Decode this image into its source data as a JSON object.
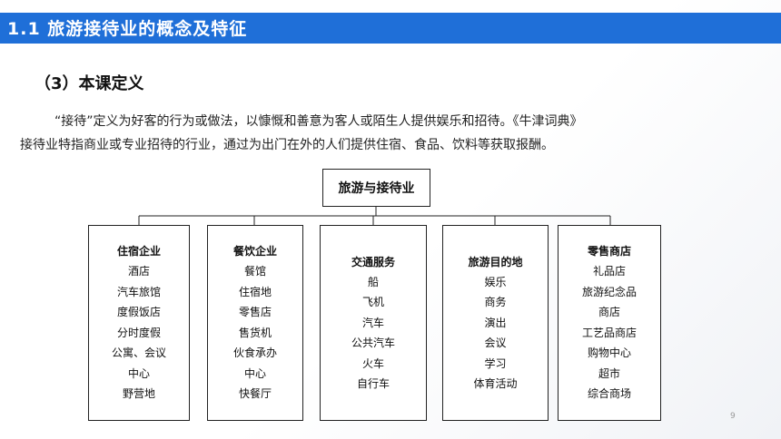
{
  "header": {
    "title": "1.1 旅游接待业的概念及特征"
  },
  "section": {
    "title": "（3）本课定义"
  },
  "paragraphs": [
    "“接待”定义为好客的行为或做法，以慷慨和善意为客人或陌生人提供娱乐和招待。《牛津词典》",
    "接待业特指商业或专业招待的行业，通过为出门在外的人们提供住宿、食品、饮料等获取报酬。"
  ],
  "diagram": {
    "root": "旅游与接待业",
    "categories": [
      {
        "title": "住宿企业",
        "items": [
          "酒店",
          "汽车旅馆",
          "度假饭店",
          "分时度假",
          "公寓、会议",
          "中心",
          "野营地"
        ]
      },
      {
        "title": "餐饮企业",
        "items": [
          "餐馆",
          "住宿地",
          "零售店",
          "售货机",
          "伙食承办",
          "中心",
          "快餐厅"
        ]
      },
      {
        "title": "交通服务",
        "items": [
          "船",
          "飞机",
          "汽车",
          "公共汽车",
          "火车",
          "自行车"
        ]
      },
      {
        "title": "旅游目的地",
        "items": [
          "娱乐",
          "商务",
          "演出",
          "会议",
          "学习",
          "体育活动"
        ]
      },
      {
        "title": "零售商店",
        "items": [
          "礼品店",
          "旅游纪念品",
          "商店",
          "工艺品商店",
          "购物中心",
          "超市",
          "综合商场"
        ]
      }
    ]
  },
  "page_number": "9",
  "colors": {
    "header_bar": "#1f6fd8",
    "header_text": "#ffffff"
  }
}
